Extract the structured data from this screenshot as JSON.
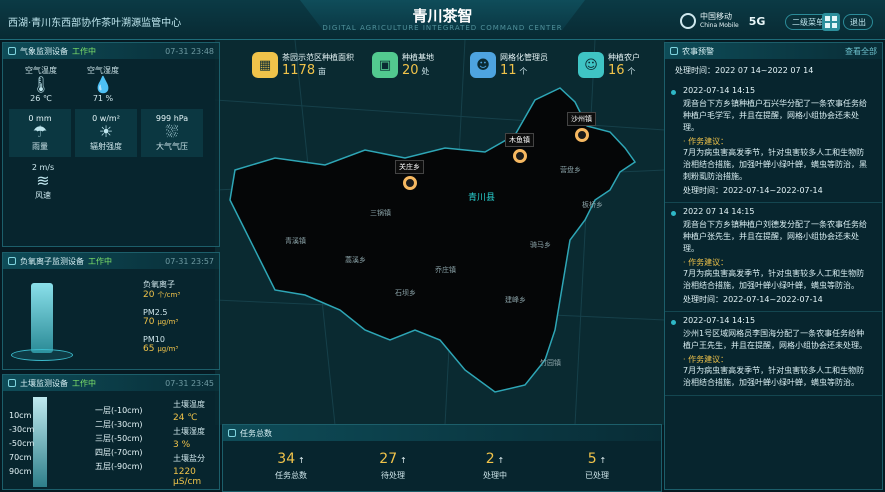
{
  "header": {
    "left_title": "西湖·青川东西部协作茶叶溯源监管中心",
    "title": "青川茶智",
    "subtitle": "DIGITAL AGRICULTURE INTEGRATED COMMAND CENTER",
    "brand_name": "中国移动",
    "brand_sub": "China Mobile",
    "brand_gen": "5G",
    "btn_overview": "二级菜单",
    "btn_close": "退出"
  },
  "weather": {
    "title": "气象监测设备",
    "status": "工作中",
    "date": "07-31 23:48",
    "items": [
      {
        "label": "空气温度",
        "value": "26 ℃",
        "icon": "thermometer-icon",
        "glyph": "🌡"
      },
      {
        "label": "空气湿度",
        "value": "71 %",
        "icon": "humidity-icon",
        "glyph": "💧"
      }
    ],
    "tiles": [
      {
        "value": "0 mm",
        "label": "雨量",
        "icon": "rain-icon",
        "glyph": "☂"
      },
      {
        "value": "0 w/m²",
        "label": "辐射强度",
        "icon": "radiation-icon",
        "glyph": "☀"
      },
      {
        "value": "999 hPa",
        "label": "大气气压",
        "icon": "pressure-icon",
        "glyph": "⛆"
      }
    ],
    "wind": {
      "value": "2 m/s",
      "label": "风速",
      "icon": "wind-icon",
      "glyph": "≋"
    }
  },
  "pm": {
    "title": "负氧离子监测设备",
    "status": "工作中",
    "date": "07-31 23:57",
    "items": [
      {
        "label": "负氧离子",
        "value": "20",
        "unit": "个/cm³"
      },
      {
        "label": "PM2.5",
        "value": "70",
        "unit": "μg/m³"
      },
      {
        "label": "PM10",
        "value": "65",
        "unit": "μg/m³"
      }
    ]
  },
  "soil": {
    "title": "土壤监测设备",
    "status": "工作中",
    "date": "07-31 23:45",
    "depths": [
      "10cm",
      "-30cm",
      "-50cm",
      "70cm",
      "90cm"
    ],
    "layers": [
      "一层(-10cm)",
      "二层(-30cm)",
      "三层(-50cm)",
      "四层(-70cm)",
      "五层(-90cm)"
    ],
    "metrics": [
      {
        "label": "土壤温度",
        "value": "24 ℃"
      },
      {
        "label": "土壤湿度",
        "value": "3 %"
      },
      {
        "label": "土壤盐分",
        "value": "1220 μS/cm"
      }
    ]
  },
  "stats": [
    {
      "label": "茶园示范区种植面积",
      "value": "1178",
      "unit": "亩",
      "icon": "tea-garden-icon",
      "glyph": "▦",
      "color": "#f0c34a"
    },
    {
      "label": "种植基地",
      "value": "20",
      "unit": "处",
      "icon": "base-icon",
      "glyph": "▣",
      "color": "#52c98f"
    },
    {
      "label": "网格化管理员",
      "value": "11",
      "unit": "个",
      "icon": "manager-icon",
      "glyph": "☻",
      "color": "#4ea4e0"
    },
    {
      "label": "种植农户",
      "value": "16",
      "unit": "个",
      "icon": "farmer-icon",
      "glyph": "☺",
      "color": "#3fc4c4"
    }
  ],
  "map": {
    "county_label": "青川县",
    "pins": [
      {
        "name": "关庄乡"
      },
      {
        "name": "木鱼镇"
      },
      {
        "name": "沙州镇"
      }
    ],
    "places": [
      "三锅镇",
      "青溪镇",
      "乔庄镇",
      "蒿溪乡",
      "石坝乡",
      "骑马乡",
      "竹园镇",
      "建峰乡",
      "营盘乡",
      "板桥乡"
    ]
  },
  "tasks": {
    "title": "任务总数",
    "items": [
      {
        "value": "34",
        "label": "任务总数"
      },
      {
        "value": "27",
        "label": "待处理"
      },
      {
        "value": "2",
        "label": "处理中"
      },
      {
        "value": "5",
        "label": "已处理"
      }
    ]
  },
  "feed": {
    "title": "农事预警",
    "more": "查看全部",
    "top_period": "处理时间：2022 07 14~2022 07 14",
    "items": [
      {
        "time": "2022-07-14 14:15",
        "body": "观音台下方乡镇种植户石兴华分配了一条农事任务给种植户毛学军，并且在提醒，网格小组协会还未处理。",
        "advice_title": "· 作务建议：",
        "advice": "7月为病虫害高发季节，针对虫害较多人工和生物防治相结合措施，加强叶蝉小绿叶蝉，螨虫等防治，黑刺粉虱防治措施。",
        "period": "处理时间：2022-07-14~2022-07-14"
      },
      {
        "time": "2022 07 14 14:15",
        "body": "观音台下方乡镇种植户刘德发分配了一条农事任务给种植户张先生，并且在提醒，网格小组协会还未处理。",
        "advice_title": "· 作务建议：",
        "advice": "7月为病虫害高发季节，针对虫害较多人工和生物防治相结合措施，加强叶蝉小绿叶蝉，螨虫等防治。",
        "period": "处理时间：2022-07-14~2022-07-14"
      },
      {
        "time": "2022-07-14 14:15",
        "body": "沙州1号区域网格员李国海分配了一条农事任务给种植户王先生，并且在提醒，网格小组协会还未处理。",
        "advice_title": "· 作务建议：",
        "advice": "7月为病虫害高发季节，针对虫害较多人工和生物防治相结合措施，加强叶蝉小绿叶蝉，螨虫等防治。",
        "period": ""
      }
    ]
  }
}
